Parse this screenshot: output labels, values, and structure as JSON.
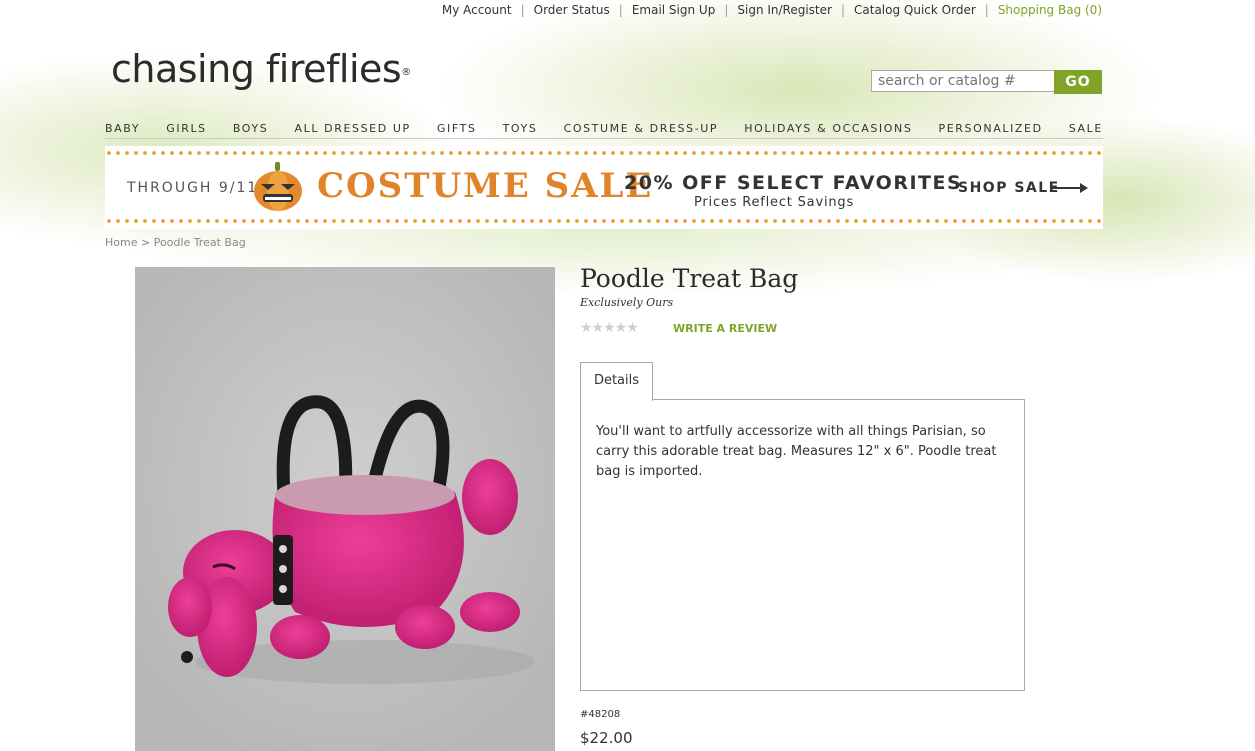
{
  "util_links": {
    "my_account": "My Account",
    "order_status": "Order Status",
    "email_signup": "Email Sign Up",
    "sign_in": "Sign In/Register",
    "catalog_quick_order": "Catalog Quick Order",
    "shopping_bag": "Shopping Bag (0)"
  },
  "logo": {
    "text": "chasing fireflies",
    "reg": "®"
  },
  "search": {
    "placeholder": "search or catalog #",
    "button": "GO"
  },
  "nav": [
    "BABY",
    "GIRLS",
    "BOYS",
    "ALL DRESSED UP",
    "GIFTS",
    "TOYS",
    "COSTUME & DRESS-UP",
    "HOLIDAYS & OCCASIONS",
    "PERSONALIZED",
    "SALE"
  ],
  "banner": {
    "through": "THROUGH 9/11",
    "headline": "COSTUME SALE",
    "offer": "20% OFF SELECT FAVORITES",
    "subtext": "Prices Reflect Savings",
    "cta": "SHOP SALE"
  },
  "breadcrumb": {
    "home": "Home",
    "sep": ">",
    "current": "Poodle Treat Bag"
  },
  "product": {
    "title": "Poodle Treat Bag",
    "subtitle": "Exclusively Ours",
    "rating": 0,
    "stars": "★★★★★",
    "review_link": "WRITE A REVIEW",
    "tab_label": "Details",
    "description": "You'll want to artfully accessorize with all things Parisian, so carry this adorable treat bag. Measures 12\" x 6\". Poodle treat bag is imported.",
    "sku": "#48208",
    "price": "$22.00"
  },
  "colors": {
    "accent_green": "#7fa427",
    "banner_orange": "#e0842a",
    "poodle_pink": "#d8237e"
  },
  "icons": [
    "pumpkin-icon",
    "arrow-right-icon"
  ]
}
